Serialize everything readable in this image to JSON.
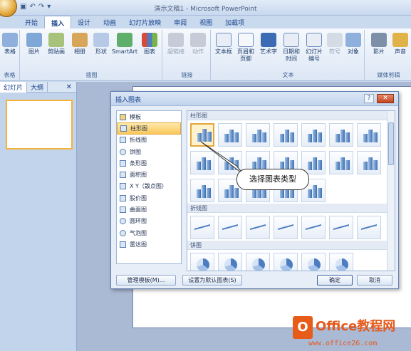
{
  "window": {
    "title": "演示文稿1 - Microsoft PowerPoint"
  },
  "tabs": [
    "开始",
    "插入",
    "设计",
    "动画",
    "幻灯片放映",
    "审阅",
    "视图",
    "加载项"
  ],
  "active_tab": "插入",
  "ribbon": {
    "groups": [
      {
        "label": "表格",
        "buttons": [
          "表格"
        ]
      },
      {
        "label": "插图",
        "buttons": [
          "图片",
          "剪贴画",
          "相册",
          "形状",
          "SmartArt",
          "图表"
        ]
      },
      {
        "label": "链接",
        "buttons": [
          "超链接",
          "动作"
        ]
      },
      {
        "label": "文本",
        "buttons": [
          "文本框",
          "页眉和页脚",
          "艺术字",
          "日期和时间",
          "幻灯片编号",
          "符号",
          "对象"
        ]
      },
      {
        "label": "媒体剪辑",
        "buttons": [
          "影片",
          "声音"
        ]
      }
    ]
  },
  "left_pane": {
    "tabs": [
      "幻灯片",
      "大纲"
    ],
    "close": "✕"
  },
  "dialog": {
    "title": "插入图表",
    "help": "?",
    "close": "✕",
    "categories": [
      "模板",
      "柱形图",
      "折线图",
      "饼图",
      "条形图",
      "面积图",
      "X Y（散点图）",
      "股价图",
      "曲面图",
      "圆环图",
      "气泡图",
      "雷达图"
    ],
    "selected_category": "柱形图",
    "sections": [
      "柱形图",
      "折线图",
      "饼图"
    ],
    "callout": "选择图表类型",
    "buttons": {
      "manage": "管理模板(M)...",
      "default": "设置为默认图表(S)",
      "ok": "确定",
      "cancel": "取消"
    }
  },
  "watermark": {
    "logo_letter": "O",
    "name": "Office教程网",
    "url": "www.office26.com"
  }
}
